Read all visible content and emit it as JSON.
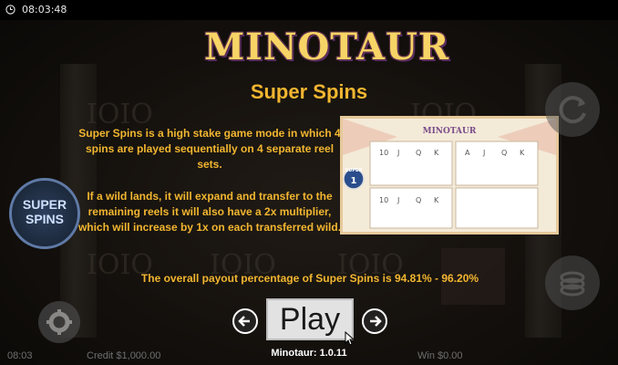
{
  "status_bar": {
    "time": "08:03:48"
  },
  "game": {
    "logo": "MINOTAUR"
  },
  "paytable": {
    "title": "Super Spins",
    "paragraph_1": "Super Spins is a high stake game mode in which 4 spins are played sequentially on 4 separate reel sets.",
    "paragraph_2": "If a wild lands, it will expand and transfer to the remaining reels it will also have a 2x multiplier, which will increase by 1x on each transferred wild.",
    "paragraph_3": "The overall payout percentage of Super Spins is 94.81% - 96.20%",
    "preview": {
      "logo": "MINOTAUR",
      "badge_label": "SUPER",
      "badge_number": "1",
      "symbols": [
        "10",
        "J",
        "Q",
        "K",
        "A",
        "J",
        "Q",
        "K",
        "10",
        "J",
        "Q",
        "K"
      ]
    }
  },
  "controls": {
    "super_spins_label": "SUPER SPINS",
    "play_label": "Play",
    "prev_icon": "arrow-left-icon",
    "next_icon": "arrow-right-icon",
    "settings_icon": "gear-icon",
    "spin_icon": "refresh-icon",
    "coins_icon": "coins-icon"
  },
  "footer": {
    "version": "Minotaur: 1.0.11",
    "time": "08:03",
    "credit": "Credit  $1,000.00",
    "win": "Win  $0.00"
  },
  "colors": {
    "gold_text": "#f2b630",
    "play_bg": "#e2e2e2"
  }
}
